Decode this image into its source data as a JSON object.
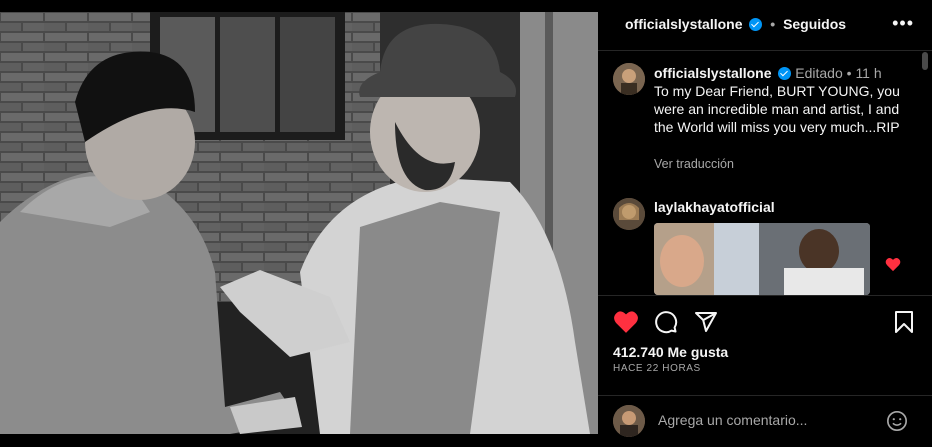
{
  "post": {
    "username": "officialslystallone",
    "follow_status": "Seguidos",
    "more_icon": "more-horizontal-icon"
  },
  "caption": {
    "username": "officialslystallone",
    "edited": "Editado",
    "time": "11 h",
    "text": "To my Dear Friend, BURT YOUNG, you were an incredible man and artist, I and the World will miss you very much...RIP",
    "translate": "Ver traducción"
  },
  "comment": {
    "username": "laylakhayatofficial",
    "liked": true
  },
  "stats": {
    "likes": "412.740 Me gusta",
    "time": "HACE 22 HORAS"
  },
  "compose": {
    "placeholder": "Agrega un comentario..."
  },
  "colors": {
    "like": "#ff3040",
    "verified": "#0095f6",
    "muted": "#a8a8a8"
  }
}
